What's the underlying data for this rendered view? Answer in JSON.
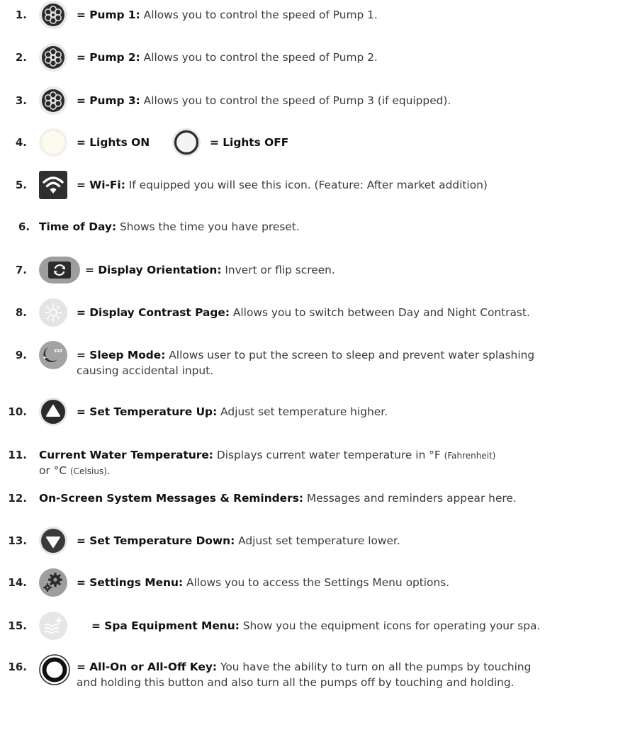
{
  "items": [
    {
      "num": "1.",
      "icon": "pump-icon",
      "prefix": "= ",
      "label": "Pump 1:",
      "desc": "  Allows you to control the speed of Pump 1."
    },
    {
      "num": "2.",
      "icon": "pump-icon",
      "prefix": "= ",
      "label": "Pump 2:",
      "desc": " Allows you to control the speed of Pump 2."
    },
    {
      "num": "3.",
      "icon": "pump-icon",
      "prefix": "= ",
      "label": "Pump 3:",
      "desc": " Allows you to control the speed of Pump 3 (if equipped)."
    },
    {
      "num": "4.",
      "icon": "light-on-icon",
      "label_on": "= Lights ON",
      "icon2": "light-off-icon",
      "label_off": "= Lights OFF"
    },
    {
      "num": "5.",
      "icon": "wifi-icon",
      "prefix": "= ",
      "label": "Wi-Fi:",
      "desc": " If equipped you will see this icon. (Feature: After market addition)"
    },
    {
      "num": "6.",
      "label": "Time of Day:",
      "desc": " Shows the time you have preset."
    },
    {
      "num": "7.",
      "icon": "display-orientation-icon",
      "prefix": "= ",
      "label": "Display Orientation:",
      "desc": " Invert or flip screen."
    },
    {
      "num": "8.",
      "icon": "contrast-icon",
      "prefix": "= ",
      "label": "Display Contrast Page:",
      "desc": " Allows you to switch between Day and Night Contrast."
    },
    {
      "num": "9.",
      "icon": "sleep-mode-icon",
      "prefix": "= ",
      "label": "Sleep Mode:",
      "desc": "  Allows user to put the screen to sleep and prevent water splashing",
      "desc2": "causing accidental input."
    },
    {
      "num": "10.",
      "icon": "temp-up-icon",
      "prefix": "= ",
      "label": "Set Temperature Up:",
      "desc": " Adjust set temperature higher."
    },
    {
      "num": "11.",
      "label": "Current Water Temperature:",
      "desc": " Displays current water temperature in °F ",
      "desc_small": "(Fahrenheit)",
      "desc2": "or °C ",
      "desc2_small": "(Celsius)",
      "desc2_end": "."
    },
    {
      "num": "12.",
      "label": "On-Screen System Messages & Reminders:",
      "desc": " Messages and reminders appear here."
    },
    {
      "num": "13.",
      "icon": "temp-down-icon",
      "prefix": "= ",
      "label": "Set Temperature Down:",
      "desc": " Adjust set temperature lower."
    },
    {
      "num": "14.",
      "icon": "gear-icon",
      "prefix": "= ",
      "label": "Settings Menu:",
      "desc": " Allows you to access the Settings Menu options."
    },
    {
      "num": "15.",
      "icon": "spa-equipment-icon",
      "prefix": "= ",
      "label": "Spa Equipment Menu:",
      "desc": " Show you the equipment icons for operating your spa."
    },
    {
      "num": "16.",
      "icon": "all-on-off-icon",
      "prefix": "= ",
      "label": "All-On or All-Off Key:",
      "desc": " You have the ability to turn on all the pumps by touching",
      "desc2": "and holding this button and also turn all the pumps off by touching and holding."
    }
  ]
}
